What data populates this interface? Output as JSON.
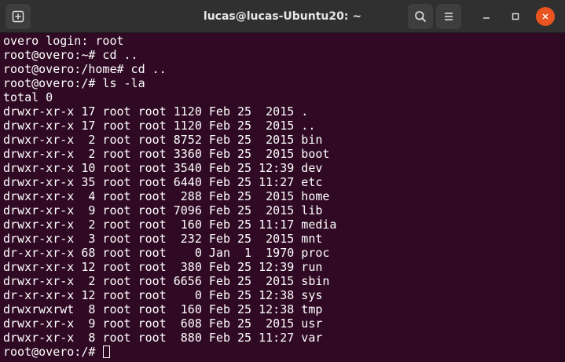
{
  "window": {
    "title": "lucas@lucas-Ubuntu20: ~"
  },
  "colors": {
    "titlebar": "#303030",
    "terminal_bg": "#300a24",
    "terminal_fg": "#ffffff",
    "close_button": "#e95420"
  },
  "terminal": {
    "lines": [
      "overo login: root",
      "root@overo:~# cd ..",
      "root@overo:/home# cd ..",
      "root@overo:/# ls -la",
      "total 0",
      "drwxr-xr-x 17 root root 1120 Feb 25  2015 .",
      "drwxr-xr-x 17 root root 1120 Feb 25  2015 ..",
      "drwxr-xr-x  2 root root 8752 Feb 25  2015 bin",
      "drwxr-xr-x  2 root root 3360 Feb 25  2015 boot",
      "drwxr-xr-x 10 root root 3540 Feb 25 12:39 dev",
      "drwxr-xr-x 35 root root 6440 Feb 25 11:27 etc",
      "drwxr-xr-x  4 root root  288 Feb 25  2015 home",
      "drwxr-xr-x  9 root root 7096 Feb 25  2015 lib",
      "drwxr-xr-x  2 root root  160 Feb 25 11:17 media",
      "drwxr-xr-x  3 root root  232 Feb 25  2015 mnt",
      "dr-xr-xr-x 68 root root    0 Jan  1  1970 proc",
      "drwxr-xr-x 12 root root  380 Feb 25 12:39 run",
      "drwxr-xr-x  2 root root 6656 Feb 25  2015 sbin",
      "dr-xr-xr-x 12 root root    0 Feb 25 12:38 sys",
      "drwxrwxrwt  8 root root  160 Feb 25 12:38 tmp",
      "drwxr-xr-x  9 root root  608 Feb 25  2015 usr",
      "drwxr-xr-x  8 root root  880 Feb 25 11:27 var"
    ],
    "prompt": "root@overo:/# "
  }
}
